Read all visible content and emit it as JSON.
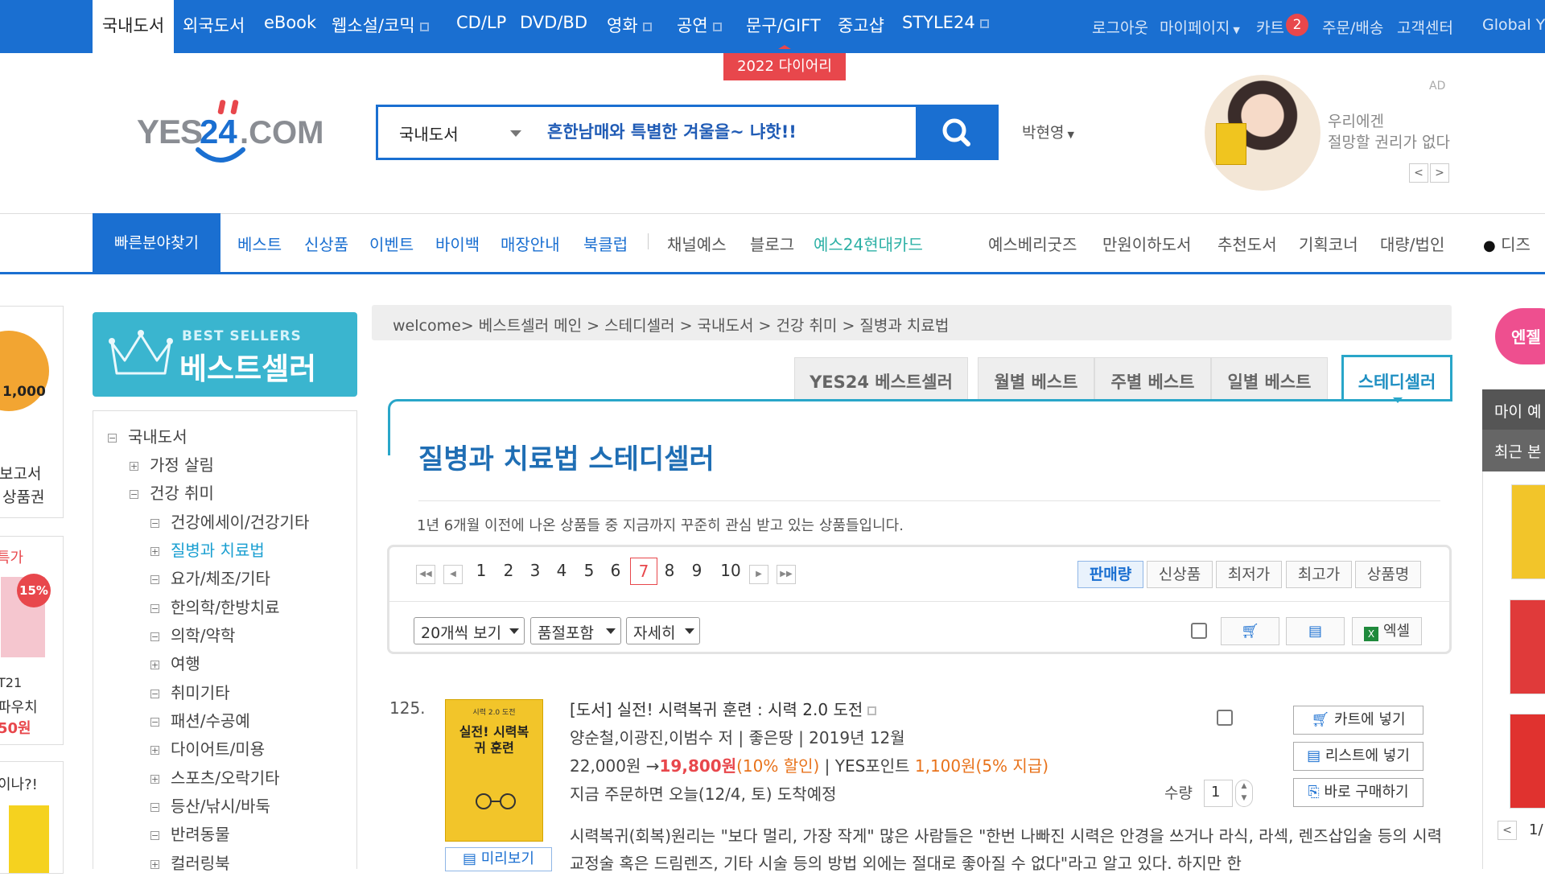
{
  "top_nav": {
    "active": "국내도서",
    "items": [
      "외국도서",
      "eBook",
      "웹소설/코믹",
      "CD/LP",
      "DVD/BD",
      "영화",
      "공연",
      "문구/GIFT",
      "중고샵",
      "STYLE24"
    ],
    "right": {
      "logout": "로그아웃",
      "mypage": "마이페이지",
      "cart": "카트",
      "cart_count": "2",
      "order": "주문/배송",
      "support": "고객센터",
      "global": "Global Y"
    },
    "promo_badge": "2022 다이어리"
  },
  "header": {
    "logo_text": "YES 24 .COM",
    "search": {
      "category": "국내도서",
      "value": "흔한남매와 특별한 겨울을~ 냐핫!!"
    },
    "user_name": "박현영",
    "ad": {
      "tag": "AD",
      "line1": "우리에겐",
      "line2": "절망할 권리가 없다"
    }
  },
  "sec_nav": {
    "quick": "빠른분야찾기",
    "left_items": [
      "베스트",
      "신상품",
      "이벤트",
      "바이백",
      "매장안내",
      "북클럽"
    ],
    "mid_items": [
      "채널예스",
      "블로그"
    ],
    "highlight": "예스24현대카드",
    "right_items": [
      "예스베리굿즈",
      "만원이하도서",
      "추천도서",
      "기획코너",
      "대량/법인"
    ],
    "disney": "디즈"
  },
  "left_rail": {
    "ad1_line1": "보고서",
    "ad1_line2": "상품권",
    "ad1_price": "1,000",
    "ad2_label": "특가",
    "ad2_pct": "15%",
    "ad2_l1": "T21",
    "ad2_l2": "파우치",
    "ad2_price": "50원",
    "ad3_label": "이나?!"
  },
  "sidebar": {
    "banner_en": "BEST SELLERS",
    "banner_ko": "베스트셀러",
    "categories": [
      {
        "label": "국내도서",
        "icon": "−"
      },
      {
        "label": "가정 살림",
        "icon": "+"
      },
      {
        "label": "건강 취미",
        "icon": "−"
      },
      {
        "label": "건강에세이/건강기타",
        "icon": "−"
      },
      {
        "label": "질병과 치료법",
        "icon": "+"
      },
      {
        "label": "요가/체조/기타",
        "icon": "−"
      },
      {
        "label": "한의학/한방치료",
        "icon": "−"
      },
      {
        "label": "의학/약학",
        "icon": "−"
      },
      {
        "label": "여행",
        "icon": "+"
      },
      {
        "label": "취미기타",
        "icon": "−"
      },
      {
        "label": "패션/수공예",
        "icon": "−"
      },
      {
        "label": "다이어트/미용",
        "icon": "+"
      },
      {
        "label": "스포츠/오락기타",
        "icon": "+"
      },
      {
        "label": "등산/낚시/바둑",
        "icon": "−"
      },
      {
        "label": "반려동물",
        "icon": "−"
      },
      {
        "label": "컬러링북",
        "icon": "+"
      }
    ]
  },
  "main": {
    "breadcrumb": "welcome> 베스트셀러 메인 > 스테디셀러 > 국내도서 > 건강 취미 > 질병과 치료법",
    "tabs": [
      "YES24 베스트셀러",
      "월별 베스트",
      "주별 베스트",
      "일별 베스트"
    ],
    "active_tab": "스테디셀러",
    "title": "질병과 치료법 스테디셀러",
    "desc": "1년 6개월 이전에 나온 상품들 중 지금까지 꾸준히 관심 받고 있는 상품들입니다.",
    "pages": [
      "1",
      "2",
      "3",
      "4",
      "5",
      "6",
      "7",
      "8",
      "9",
      "10"
    ],
    "current_page": "7",
    "sort": [
      "판매량",
      "신상품",
      "최저가",
      "최고가",
      "상품명"
    ],
    "selects": [
      "20개씩 보기",
      "품절포함",
      "자세히"
    ],
    "excel_label": "엑셀"
  },
  "product": {
    "rank": "125.",
    "cover_title": "실전! 시력복귀 훈련",
    "cover_top": "시력 2.0 도전",
    "title": "[도서] 실전! 시력복귀 훈련 : 시력 2.0 도전",
    "meta": "양순철,이광진,이범수 저 | 좋은땅 | 2019년 12월",
    "price_orig": "22,000원",
    "price_arrow": " →",
    "price_sale": "19,800원",
    "discount": "(10% 할인)",
    "points_label": " | YES포인트 ",
    "points": "1,100원",
    "points_rate": "(5% 지급)",
    "delivery": "지금 주문하면 오늘(12/4, 토) 도착예정",
    "description": "시력복귀(회복)원리는 \"보다 멀리, 가장 작게\" 많은 사람들은 \"한번 나빠진 시력은 안경을 쓰거나 라식, 라섹, 렌즈삽입술 등의 시력교정술 혹은 드림렌즈, 기타 시술 등의 방법 외에는 절대로 좋아질 수 없다\"라고 알고 있다. 하지만 한",
    "preview": "미리보기",
    "qty_label": "수량",
    "qty": "1",
    "buttons": {
      "cart": "카트에 넣기",
      "list": "리스트에 넣기",
      "buy": "바로 구매하기"
    }
  },
  "right_rail": {
    "tag": "엔젤",
    "my": "마이 예",
    "recent": "최근 본",
    "page": "1/"
  }
}
